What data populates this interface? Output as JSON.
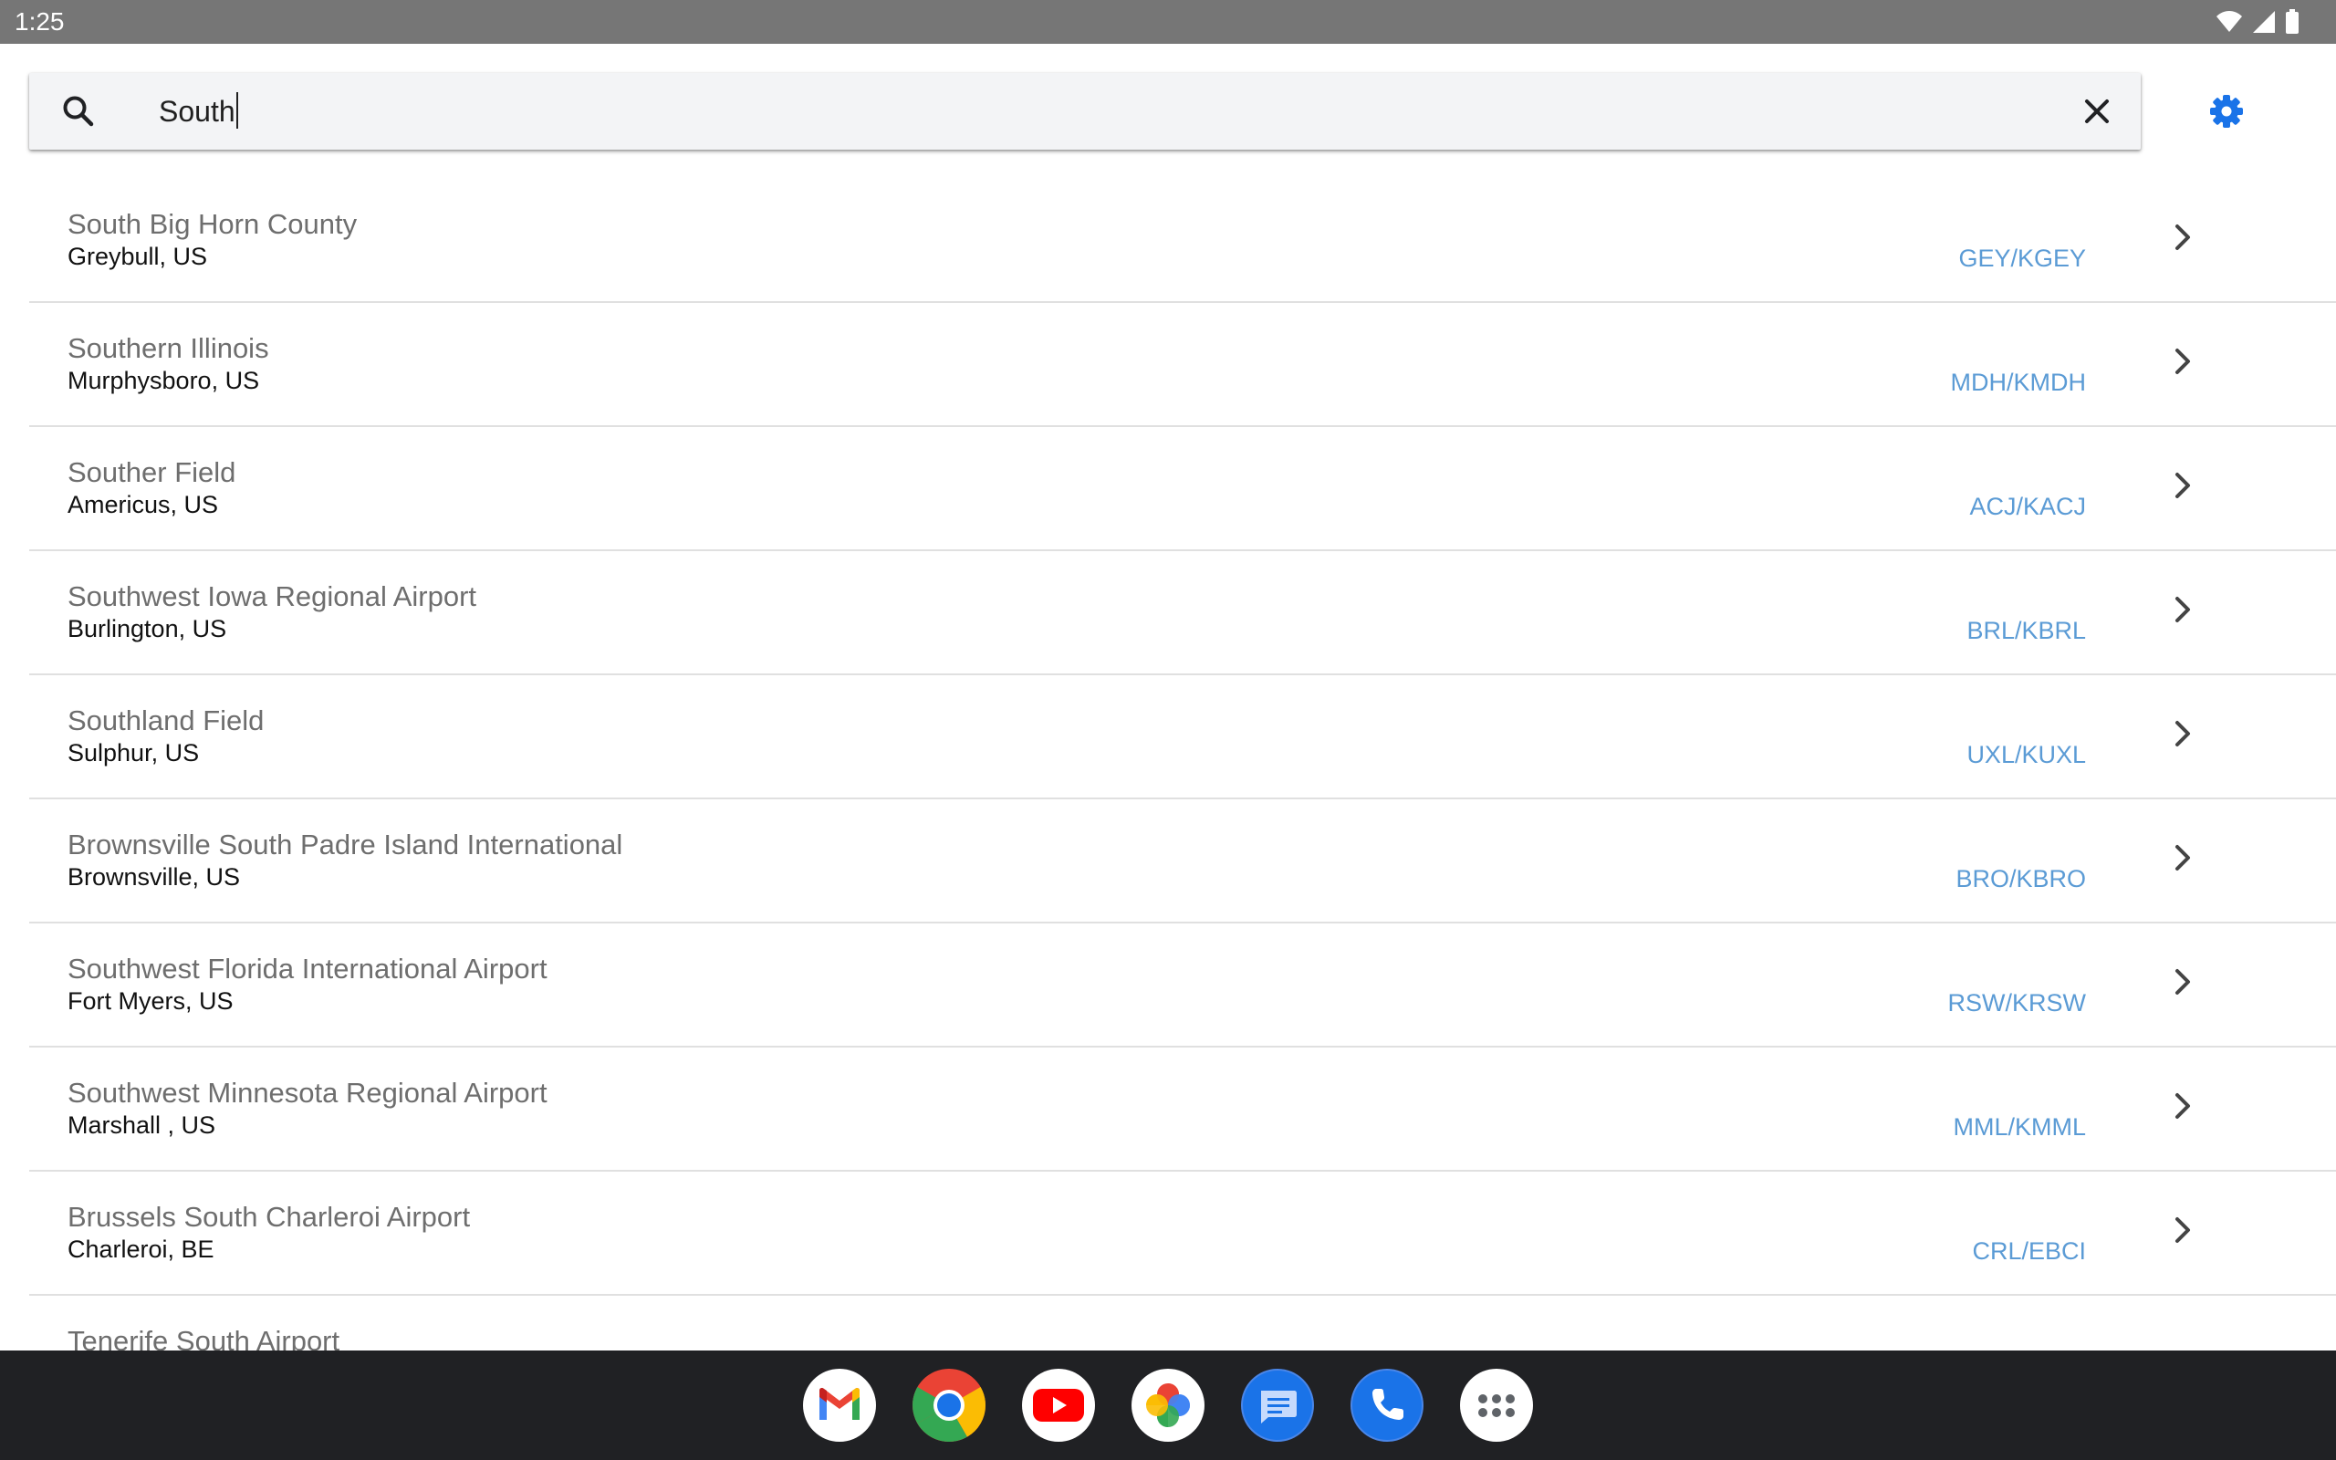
{
  "status_bar": {
    "time": "1:25",
    "icons": [
      "wifi-icon",
      "cellular-signal-icon",
      "battery-icon"
    ]
  },
  "search": {
    "value": "South",
    "icon": "search-icon",
    "clear_icon": "close-icon"
  },
  "settings": {
    "icon": "gear-icon",
    "color": "#1a73e8"
  },
  "results": [
    {
      "name": "South Big Horn County",
      "location": "Greybull, US",
      "code": "GEY/KGEY"
    },
    {
      "name": "Southern Illinois",
      "location": "Murphysboro, US",
      "code": "MDH/KMDH"
    },
    {
      "name": "Souther Field",
      "location": "Americus, US",
      "code": "ACJ/KACJ"
    },
    {
      "name": "Southwest Iowa Regional Airport",
      "location": "Burlington, US",
      "code": "BRL/KBRL"
    },
    {
      "name": "Southland Field",
      "location": "Sulphur, US",
      "code": "UXL/KUXL"
    },
    {
      "name": "Brownsville South Padre Island International",
      "location": "Brownsville, US",
      "code": "BRO/KBRO"
    },
    {
      "name": "Southwest Florida International Airport",
      "location": "Fort Myers, US",
      "code": "RSW/KRSW"
    },
    {
      "name": "Southwest Minnesota Regional Airport",
      "location": "Marshall , US",
      "code": "MML/KMML"
    },
    {
      "name": "Brussels South Charleroi Airport",
      "location": "Charleroi, BE",
      "code": "CRL/EBCI"
    },
    {
      "name": "Tenerife South Airport",
      "location": "",
      "code": ""
    }
  ],
  "dock": {
    "apps": [
      "gmail-icon",
      "chrome-icon",
      "youtube-icon",
      "photos-icon",
      "messages-icon",
      "phone-icon",
      "app-drawer-icon"
    ]
  },
  "colors": {
    "accent": "#1a73e8",
    "code_text": "#5b9bd5",
    "status_bar": "#767676",
    "dock": "#202124"
  }
}
